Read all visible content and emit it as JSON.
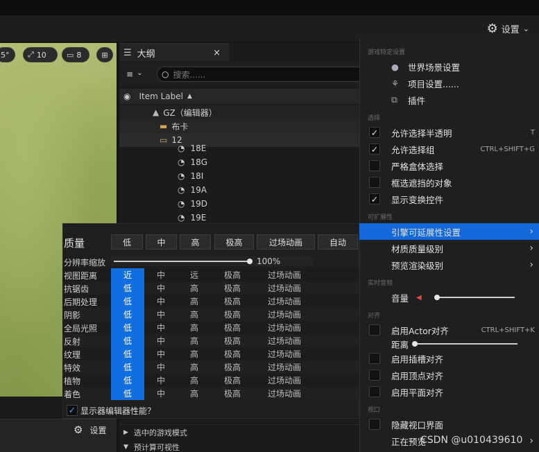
{
  "topbar": {
    "settings_label": "设置"
  },
  "viewport": {
    "buttons": [
      {
        "icon": "angle-icon",
        "label": "5°"
      },
      {
        "icon": "scale-icon",
        "label": "10"
      },
      {
        "icon": "camera-icon",
        "label": "8"
      },
      {
        "icon": "layout-icon",
        "label": ""
      }
    ],
    "bottom_settings_label": "设置"
  },
  "outliner": {
    "tab_label": "大纲",
    "search_placeholder": "搜索......",
    "column_header": "Item Label",
    "items": [
      {
        "label": "GZ（编辑器）",
        "icon": "level-icon",
        "indent": 0
      },
      {
        "label": "布卡",
        "icon": "folder-icon",
        "indent": 1
      },
      {
        "label": "12",
        "icon": "folder-open-icon",
        "indent": 1
      },
      {
        "label": "18E",
        "icon": "actor-icon",
        "indent": 2
      },
      {
        "label": "18G",
        "icon": "actor-icon",
        "indent": 2
      },
      {
        "label": "18I",
        "icon": "actor-icon",
        "indent": 2
      },
      {
        "label": "19A",
        "icon": "actor-icon",
        "indent": 2
      },
      {
        "label": "19D",
        "icon": "actor-icon",
        "indent": 2
      },
      {
        "label": "19E",
        "icon": "actor-icon",
        "indent": 2
      }
    ],
    "bottom_rows": [
      "选中的游戏模式",
      "预计算可视性"
    ]
  },
  "quality": {
    "title": "质量",
    "presets": [
      "低",
      "中",
      "高",
      "极高",
      "过场动画",
      "自动"
    ],
    "resolution_label": "分辨率缩放",
    "resolution_value": "100%",
    "resolution_fraction": 1.0,
    "rows": [
      {
        "label": "视图距离",
        "options": [
          "近",
          "中",
          "远",
          "极高",
          "过场动画"
        ],
        "selected": 0
      },
      {
        "label": "抗锯齿",
        "options": [
          "低",
          "中",
          "高",
          "极高",
          "过场动画"
        ],
        "selected": 0
      },
      {
        "label": "后期处理",
        "options": [
          "低",
          "中",
          "高",
          "极高",
          "过场动画"
        ],
        "selected": 0
      },
      {
        "label": "阴影",
        "options": [
          "低",
          "中",
          "高",
          "极高",
          "过场动画"
        ],
        "selected": 0
      },
      {
        "label": "全局光照",
        "options": [
          "低",
          "中",
          "高",
          "极高",
          "过场动画"
        ],
        "selected": 0
      },
      {
        "label": "反射",
        "options": [
          "低",
          "中",
          "高",
          "极高",
          "过场动画"
        ],
        "selected": 0
      },
      {
        "label": "纹理",
        "options": [
          "低",
          "中",
          "高",
          "极高",
          "过场动画"
        ],
        "selected": 0
      },
      {
        "label": "特效",
        "options": [
          "低",
          "中",
          "高",
          "极高",
          "过场动画"
        ],
        "selected": 0
      },
      {
        "label": "植物",
        "options": [
          "低",
          "中",
          "高",
          "极高",
          "过场动画"
        ],
        "selected": 0
      },
      {
        "label": "着色",
        "options": [
          "低",
          "中",
          "高",
          "极高",
          "过场动画"
        ],
        "selected": 0
      }
    ],
    "perf_checkbox_label": "显示器编辑器性能？",
    "perf_checked": true
  },
  "menu": {
    "sections": {
      "game": "游戏特定设置",
      "select": "选择",
      "ext": "可扩展性",
      "audio": "实时音频",
      "snap": "对齐",
      "viewport": "视口"
    },
    "world_settings": "世界场景设置",
    "project_settings": "项目设置......",
    "plugins": "插件",
    "allow_translucent": "允许选择半透明",
    "allow_translucent_shortcut": "T",
    "allow_group": "允许选择组",
    "allow_group_shortcut": "CTRL+SHIFT+G",
    "strict_box": "严格盒体选择",
    "box_occluded": "框选遮挡的对象",
    "show_transform": "显示变换控件",
    "engine_scalability": "引擎可延展性设置",
    "material_quality": "材质质量级别",
    "preview_render": "预览渲染级别",
    "volume": "音量",
    "volume_fraction": 0.0,
    "actor_snap": "启用Actor对齐",
    "actor_snap_shortcut": "CTRL+SHIFT+K",
    "distance": "距离",
    "distance_fraction": 0.0,
    "socket_snap": "启用插槽对齐",
    "vertex_snap": "启用顶点对齐",
    "plane_snap": "启用平面对齐",
    "hide_viewport_ui": "隐藏视口界面",
    "preview_partial": "正在预览",
    "watermark": "CSDN @u010439610"
  },
  "colors": {
    "accent": "#1268d8",
    "selected_cell": "#0f6fe0"
  }
}
